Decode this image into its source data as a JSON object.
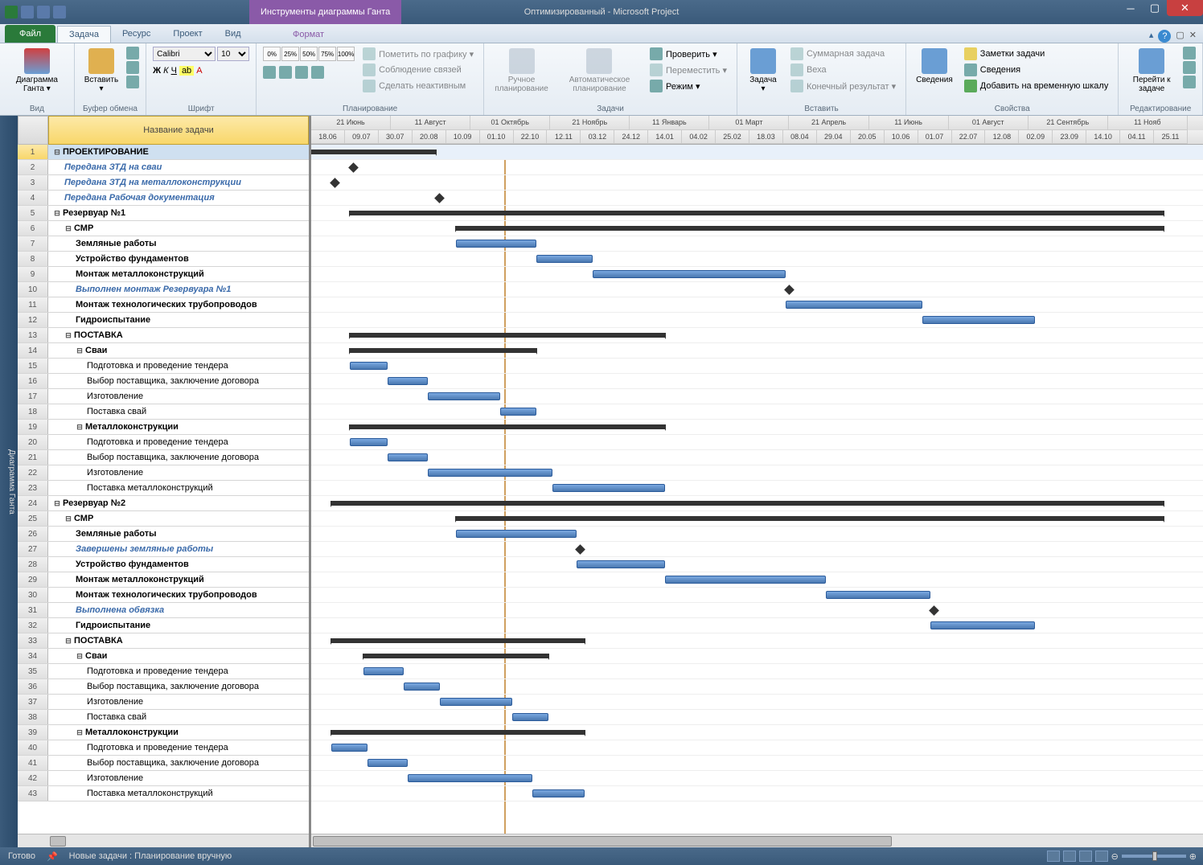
{
  "title": {
    "tool_tab": "Инструменты диаграммы Ганта",
    "doc": "Оптимизированный - Microsoft Project"
  },
  "tabs": {
    "file": "Файл",
    "items": [
      "Задача",
      "Ресурс",
      "Проект",
      "Вид"
    ],
    "active": 0,
    "format": "Формат"
  },
  "ribbon": {
    "view_btn": "Диаграмма Ганта ▾",
    "paste": "Вставить ▾",
    "clipboard": "Буфер обмена",
    "font_name": "Calibri",
    "font_size": "10",
    "font_grp": "Шрифт",
    "pcts": [
      "0%",
      "25%",
      "50%",
      "75%",
      "100%"
    ],
    "plan_grp": "Планирование",
    "plan1": "Пометить по графику ▾",
    "plan2": "Соблюдение связей",
    "plan3": "Сделать неактивным",
    "manual": "Ручное планирование",
    "auto": "Автоматическое планирование",
    "tasks_grp": "Задачи",
    "inspect": "Проверить ▾",
    "move": "Переместить ▾",
    "mode": "Режим ▾",
    "task_btn": "Задача ▾",
    "ins1": "Суммарная задача",
    "ins2": "Веха",
    "ins3": "Конечный результат ▾",
    "ins_grp": "Вставить",
    "info": "Сведения",
    "prop1": "Заметки задачи",
    "prop2": "Сведения",
    "prop3": "Добавить на временную шкалу",
    "prop_grp": "Свойства",
    "scroll": "Перейти к задаче",
    "edit_grp": "Редактирование"
  },
  "timeline": {
    "months": [
      "21 Июнь",
      "11 Август",
      "01 Октябрь",
      "21 Ноябрь",
      "11 Январь",
      "01 Март",
      "21 Апрель",
      "11 Июнь",
      "01 Август",
      "21 Сентябрь",
      "11 Нояб"
    ],
    "days": [
      "18.06",
      "09.07",
      "30.07",
      "20.08",
      "10.09",
      "01.10",
      "22.10",
      "12.11",
      "03.12",
      "24.12",
      "14.01",
      "04.02",
      "25.02",
      "18.03",
      "08.04",
      "29.04",
      "20.05",
      "10.06",
      "01.07",
      "22.07",
      "12.08",
      "02.09",
      "23.09",
      "14.10",
      "04.11",
      "25.11"
    ]
  },
  "col_header": "Название задачи",
  "sidebar": "Диаграмма Ганта",
  "rows": [
    {
      "n": 1,
      "t": "ПРОЕКТИРОВАНИЕ",
      "lvl": 0,
      "out": "-",
      "typ": "sum",
      "s": 0,
      "e": 155,
      "sel": true
    },
    {
      "n": 2,
      "t": "Передана ЗТД на сваи",
      "lvl": 1,
      "typ": "ms",
      "s": 48,
      "mile": true
    },
    {
      "n": 3,
      "t": "Передана ЗТД на металлоконструкции",
      "lvl": 1,
      "typ": "ms",
      "s": 25,
      "mile": true
    },
    {
      "n": 4,
      "t": "Передана Рабочая документация",
      "lvl": 1,
      "typ": "ms",
      "s": 155,
      "mile": true
    },
    {
      "n": 5,
      "t": "Резервуар №1",
      "lvl": 0,
      "out": "-",
      "typ": "sum",
      "s": 48,
      "e": 1060
    },
    {
      "n": 6,
      "t": "СМР",
      "lvl": 1,
      "out": "-",
      "typ": "sum",
      "s": 180,
      "e": 1060
    },
    {
      "n": 7,
      "t": "Земляные работы",
      "lvl": 2,
      "typ": "bar",
      "s": 180,
      "e": 280
    },
    {
      "n": 8,
      "t": "Устройство фундаментов",
      "lvl": 2,
      "typ": "bar",
      "s": 280,
      "e": 350
    },
    {
      "n": 9,
      "t": "Монтаж металлоконструкций",
      "lvl": 2,
      "typ": "bar",
      "s": 350,
      "e": 590
    },
    {
      "n": 10,
      "t": "Выполнен монтаж Резервуара №1",
      "lvl": 2,
      "typ": "ms",
      "s": 590,
      "mile": true
    },
    {
      "n": 11,
      "t": "Монтаж технологических трубопроводов",
      "lvl": 2,
      "typ": "bar",
      "s": 590,
      "e": 760
    },
    {
      "n": 12,
      "t": "Гидроиспытание",
      "lvl": 2,
      "typ": "bar",
      "s": 760,
      "e": 900
    },
    {
      "n": 13,
      "t": "ПОСТАВКА",
      "lvl": 1,
      "out": "-",
      "typ": "sum",
      "s": 48,
      "e": 440
    },
    {
      "n": 14,
      "t": "Сваи",
      "lvl": 2,
      "out": "-",
      "typ": "sum",
      "s": 48,
      "e": 280
    },
    {
      "n": 15,
      "t": "Подготовка и проведение тендера",
      "lvl": 3,
      "typ": "bar",
      "s": 48,
      "e": 95
    },
    {
      "n": 16,
      "t": "Выбор поставщика, заключение договора",
      "lvl": 3,
      "typ": "bar",
      "s": 95,
      "e": 145
    },
    {
      "n": 17,
      "t": "Изготовление",
      "lvl": 3,
      "typ": "bar",
      "s": 145,
      "e": 235
    },
    {
      "n": 18,
      "t": "Поставка свай",
      "lvl": 3,
      "typ": "bar",
      "s": 235,
      "e": 280
    },
    {
      "n": 19,
      "t": "Металлоконструкции",
      "lvl": 2,
      "out": "-",
      "typ": "sum",
      "s": 48,
      "e": 440
    },
    {
      "n": 20,
      "t": "Подготовка и проведение тендера",
      "lvl": 3,
      "typ": "bar",
      "s": 48,
      "e": 95
    },
    {
      "n": 21,
      "t": "Выбор поставщика, заключение договора",
      "lvl": 3,
      "typ": "bar",
      "s": 95,
      "e": 145
    },
    {
      "n": 22,
      "t": "Изготовление",
      "lvl": 3,
      "typ": "bar",
      "s": 145,
      "e": 300
    },
    {
      "n": 23,
      "t": "Поставка металлоконструкций",
      "lvl": 3,
      "typ": "bar",
      "s": 300,
      "e": 440
    },
    {
      "n": 24,
      "t": "Резервуар №2",
      "lvl": 0,
      "out": "-",
      "typ": "sum",
      "s": 25,
      "e": 1060
    },
    {
      "n": 25,
      "t": "СМР",
      "lvl": 1,
      "out": "-",
      "typ": "sum",
      "s": 180,
      "e": 1060
    },
    {
      "n": 26,
      "t": "Земляные работы",
      "lvl": 2,
      "typ": "bar",
      "s": 180,
      "e": 330
    },
    {
      "n": 27,
      "t": "Завершены земляные работы",
      "lvl": 2,
      "typ": "ms",
      "s": 330,
      "mile": true
    },
    {
      "n": 28,
      "t": "Устройство фундаментов",
      "lvl": 2,
      "typ": "bar",
      "s": 330,
      "e": 440
    },
    {
      "n": 29,
      "t": "Монтаж металлоконструкций",
      "lvl": 2,
      "typ": "bar",
      "s": 440,
      "e": 640
    },
    {
      "n": 30,
      "t": "Монтаж технологических трубопроводов",
      "lvl": 2,
      "typ": "bar",
      "s": 640,
      "e": 770
    },
    {
      "n": 31,
      "t": "Выполнена обвязка",
      "lvl": 2,
      "typ": "ms",
      "s": 770,
      "mile": true
    },
    {
      "n": 32,
      "t": "Гидроиспытание",
      "lvl": 2,
      "typ": "bar",
      "s": 770,
      "e": 900
    },
    {
      "n": 33,
      "t": "ПОСТАВКА",
      "lvl": 1,
      "out": "-",
      "typ": "sum",
      "s": 25,
      "e": 340
    },
    {
      "n": 34,
      "t": "Сваи",
      "lvl": 2,
      "out": "-",
      "typ": "sum",
      "s": 65,
      "e": 295
    },
    {
      "n": 35,
      "t": "Подготовка и проведение тендера",
      "lvl": 3,
      "typ": "bar",
      "s": 65,
      "e": 115
    },
    {
      "n": 36,
      "t": "Выбор поставщика, заключение договора",
      "lvl": 3,
      "typ": "bar",
      "s": 115,
      "e": 160
    },
    {
      "n": 37,
      "t": "Изготовление",
      "lvl": 3,
      "typ": "bar",
      "s": 160,
      "e": 250
    },
    {
      "n": 38,
      "t": "Поставка свай",
      "lvl": 3,
      "typ": "bar",
      "s": 250,
      "e": 295
    },
    {
      "n": 39,
      "t": "Металлоконструкции",
      "lvl": 2,
      "out": "-",
      "typ": "sum",
      "s": 25,
      "e": 340
    },
    {
      "n": 40,
      "t": "Подготовка и проведение тендера",
      "lvl": 3,
      "typ": "bar",
      "s": 25,
      "e": 70
    },
    {
      "n": 41,
      "t": "Выбор поставщика, заключение договора",
      "lvl": 3,
      "typ": "bar",
      "s": 70,
      "e": 120
    },
    {
      "n": 42,
      "t": "Изготовление",
      "lvl": 3,
      "typ": "bar",
      "s": 120,
      "e": 275
    },
    {
      "n": 43,
      "t": "Поставка металлоконструкций",
      "lvl": 3,
      "typ": "bar",
      "s": 275,
      "e": 340
    }
  ],
  "status": {
    "ready": "Готово",
    "new_tasks": "Новые задачи : Планирование вручную"
  }
}
